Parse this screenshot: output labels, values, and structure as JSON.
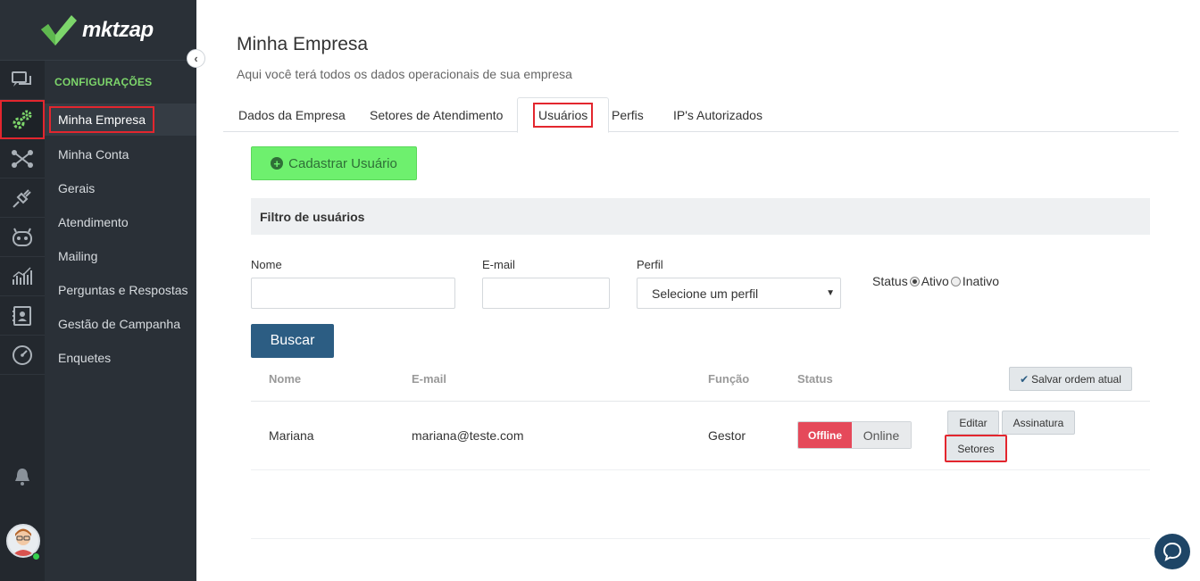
{
  "brand": {
    "name": "mktzap",
    "accent": "#7dd66b"
  },
  "rail": {
    "items": [
      {
        "icon": "chat-icon"
      },
      {
        "icon": "gears-icon",
        "active": true
      },
      {
        "icon": "flow-icon"
      },
      {
        "icon": "plug-icon"
      },
      {
        "icon": "bot-icon"
      },
      {
        "icon": "stats-icon"
      },
      {
        "icon": "contacts-icon"
      },
      {
        "icon": "speedometer-icon"
      }
    ],
    "bell_icon": "bell-icon"
  },
  "menu": {
    "title": "CONFIGURAÇÕES",
    "items": [
      {
        "label": "Minha Empresa",
        "active": true
      },
      {
        "label": "Minha Conta"
      },
      {
        "label": "Gerais"
      },
      {
        "label": "Atendimento"
      },
      {
        "label": "Mailing"
      },
      {
        "label": "Perguntas e Respostas"
      },
      {
        "label": "Gestão de Campanha"
      },
      {
        "label": "Enquetes"
      }
    ]
  },
  "page": {
    "title": "Minha Empresa",
    "subtitle": "Aqui você terá todos os dados operacionais de sua empresa"
  },
  "tabs": [
    {
      "label": "Dados da Empresa"
    },
    {
      "label": "Setores de Atendimento"
    },
    {
      "label": "Usuários",
      "active": true
    },
    {
      "label": "Perfis"
    },
    {
      "label": "IP's Autorizados"
    }
  ],
  "actions": {
    "add_user": "Cadastrar Usuário"
  },
  "filter": {
    "title": "Filtro de usuários",
    "name_label": "Nome",
    "name_value": "",
    "email_label": "E-mail",
    "email_value": "",
    "profile_label": "Perfil",
    "profile_selected": "Selecione um perfil",
    "status_label": "Status",
    "status_active": "Ativo",
    "status_inactive": "Inativo",
    "status_selected": "Ativo",
    "search_button": "Buscar"
  },
  "table": {
    "headers": {
      "name": "Nome",
      "email": "E-mail",
      "role": "Função",
      "status": "Status"
    },
    "save_order": "Salvar ordem atual",
    "rows": [
      {
        "name": "Mariana",
        "email": "mariana@teste.com",
        "role": "Gestor",
        "status_off": "Offline",
        "status_on": "Online",
        "status_current": "Offline",
        "edit": "Editar",
        "signature": "Assinatura",
        "sectors": "Setores"
      }
    ]
  }
}
